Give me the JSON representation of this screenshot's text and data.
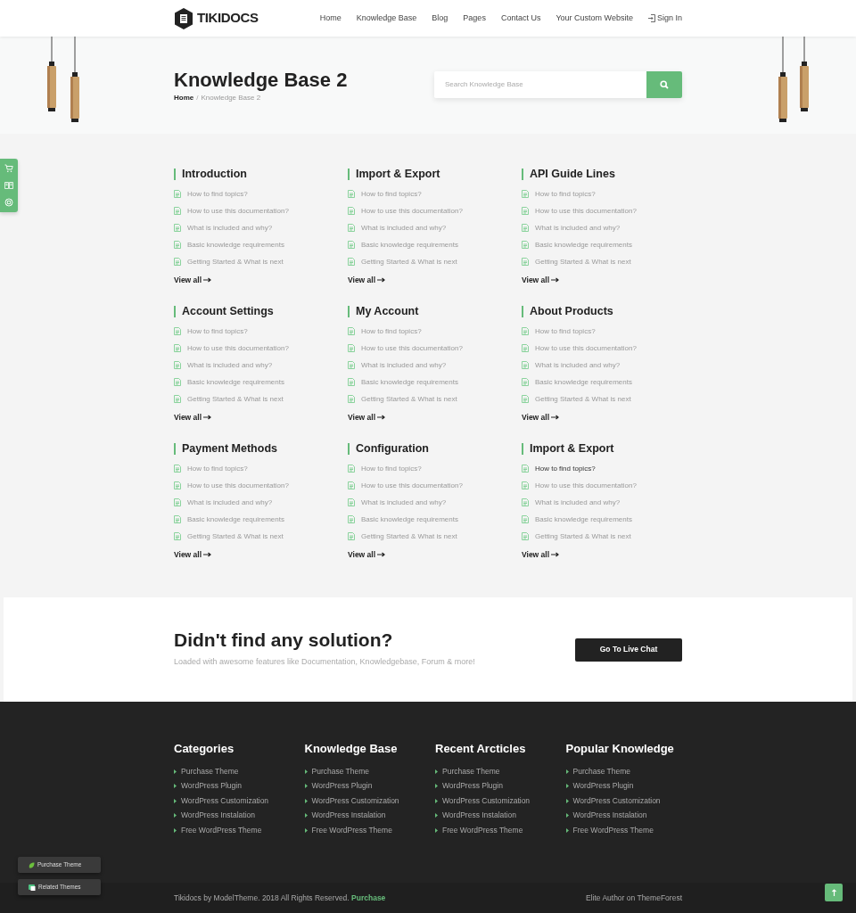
{
  "header": {
    "logo": "TIKIDOCS",
    "nav": [
      {
        "label": "Home"
      },
      {
        "label": "Knowledge Base"
      },
      {
        "label": "Blog"
      },
      {
        "label": "Pages"
      },
      {
        "label": "Contact Us"
      },
      {
        "label": "Your Custom Website"
      }
    ],
    "sign_in": "Sign In"
  },
  "hero": {
    "title": "Knowledge Base 2",
    "breadcrumb": {
      "home": "Home",
      "separator": "/",
      "current": "Knowledge Base 2"
    },
    "search": {
      "placeholder": "Search Knowledge Base"
    }
  },
  "categories": [
    {
      "title": "Introduction",
      "links": [
        {
          "label": "How to find topics?",
          "hovered": false
        },
        {
          "label": "How to use this documentation?",
          "hovered": false
        },
        {
          "label": "What is included and why?",
          "hovered": false
        },
        {
          "label": "Basic knowledge requirements",
          "hovered": false
        },
        {
          "label": "Getting Started & What is next",
          "hovered": false
        }
      ],
      "view_all": "View all"
    },
    {
      "title": "Import & Export",
      "links": [
        {
          "label": "How to find topics?",
          "hovered": false
        },
        {
          "label": "How to use this documentation?",
          "hovered": false
        },
        {
          "label": "What is included and why?",
          "hovered": false
        },
        {
          "label": "Basic knowledge requirements",
          "hovered": false
        },
        {
          "label": "Getting Started & What is next",
          "hovered": false
        }
      ],
      "view_all": "View all"
    },
    {
      "title": "API Guide Lines",
      "links": [
        {
          "label": "How to find topics?",
          "hovered": false
        },
        {
          "label": "How to use this documentation?",
          "hovered": false
        },
        {
          "label": "What is included and why?",
          "hovered": false
        },
        {
          "label": "Basic knowledge requirements",
          "hovered": false
        },
        {
          "label": "Getting Started & What is next",
          "hovered": false
        }
      ],
      "view_all": "View all"
    },
    {
      "title": "Account Settings",
      "links": [
        {
          "label": "How to find topics?",
          "hovered": false
        },
        {
          "label": "How to use this documentation?",
          "hovered": false
        },
        {
          "label": "What is included and why?",
          "hovered": false
        },
        {
          "label": "Basic knowledge requirements",
          "hovered": false
        },
        {
          "label": "Getting Started & What is next",
          "hovered": false
        }
      ],
      "view_all": "View all"
    },
    {
      "title": "My Account",
      "links": [
        {
          "label": "How to find topics?",
          "hovered": false
        },
        {
          "label": "How to use this documentation?",
          "hovered": false
        },
        {
          "label": "What is included and why?",
          "hovered": false
        },
        {
          "label": "Basic knowledge requirements",
          "hovered": false
        },
        {
          "label": "Getting Started & What is next",
          "hovered": false
        }
      ],
      "view_all": "View all"
    },
    {
      "title": "About Products",
      "links": [
        {
          "label": "How to find topics?",
          "hovered": false
        },
        {
          "label": "How to use this documentation?",
          "hovered": false
        },
        {
          "label": "What is included and why?",
          "hovered": false
        },
        {
          "label": "Basic knowledge requirements",
          "hovered": false
        },
        {
          "label": "Getting Started & What is next",
          "hovered": false
        }
      ],
      "view_all": "View all"
    },
    {
      "title": "Payment Methods",
      "links": [
        {
          "label": "How to find topics?",
          "hovered": false
        },
        {
          "label": "How to use this documentation?",
          "hovered": false
        },
        {
          "label": "What is included and why?",
          "hovered": false
        },
        {
          "label": "Basic knowledge requirements",
          "hovered": false
        },
        {
          "label": "Getting Started & What is next",
          "hovered": false
        }
      ],
      "view_all": "View all"
    },
    {
      "title": "Configuration",
      "links": [
        {
          "label": "How to find topics?",
          "hovered": false
        },
        {
          "label": "How to use this documentation?",
          "hovered": false
        },
        {
          "label": "What is included and why?",
          "hovered": false
        },
        {
          "label": "Basic knowledge requirements",
          "hovered": false
        },
        {
          "label": "Getting Started & What is next",
          "hovered": false
        }
      ],
      "view_all": "View all"
    },
    {
      "title": "Import & Export",
      "links": [
        {
          "label": "How to find topics?",
          "hovered": true
        },
        {
          "label": "How to use this documentation?",
          "hovered": false
        },
        {
          "label": "What is included and why?",
          "hovered": false
        },
        {
          "label": "Basic knowledge requirements",
          "hovered": false
        },
        {
          "label": "Getting Started & What is next",
          "hovered": false
        }
      ],
      "view_all": "View all"
    }
  ],
  "cta": {
    "title": "Didn't find any solution?",
    "subtitle": "Loaded with awesome features like Documentation, Knowledgebase, Forum & more!",
    "button": "Go To Live Chat"
  },
  "footer": {
    "columns": [
      {
        "title": "Categories",
        "links": [
          "Purchase Theme",
          "WordPress Plugin",
          "WordPress Customization",
          "WordPress Instalation",
          "Free WordPress Theme"
        ]
      },
      {
        "title": "Knowledge Base",
        "links": [
          "Purchase Theme",
          "WordPress Plugin",
          "WordPress Customization",
          "WordPress Instalation",
          "Free WordPress Theme"
        ]
      },
      {
        "title": "Recent Arcticles",
        "links": [
          "Purchase Theme",
          "WordPress Plugin",
          "WordPress Customization",
          "WordPress Instalation",
          "Free WordPress Theme"
        ]
      },
      {
        "title": "Popular Knowledge",
        "links": [
          "Purchase Theme",
          "WordPress Plugin",
          "WordPress Customization",
          "WordPress Instalation",
          "Free WordPress Theme"
        ]
      }
    ],
    "copyright": "Tikidocs by ModelTheme. 2018 All Rights Reserved.",
    "purchase_link": "Purchase",
    "author": "Elite Author on ThemeForest"
  },
  "floating_buttons": [
    {
      "label": "Purchase Theme",
      "kind": "leaf"
    },
    {
      "label": "Related Themes",
      "kind": "themes"
    }
  ]
}
